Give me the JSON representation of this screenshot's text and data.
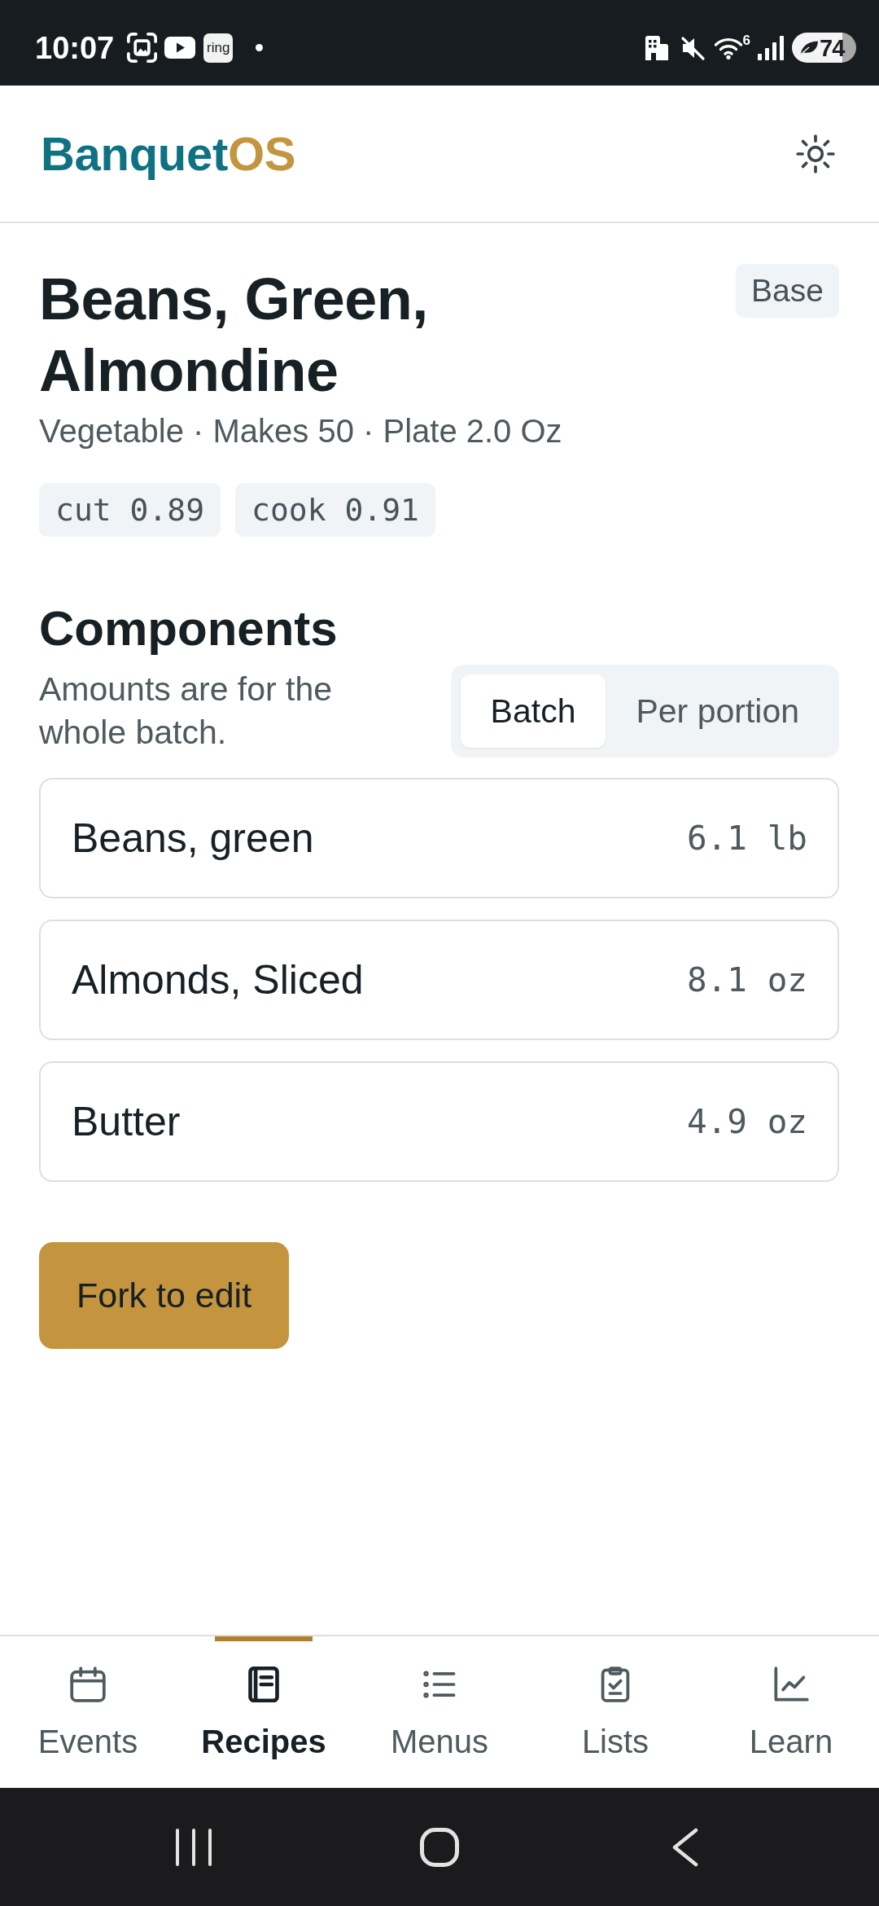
{
  "status_bar": {
    "time": "10:07",
    "app_icon_label": "ring",
    "wifi_band": "6",
    "battery": "74"
  },
  "header": {
    "logo": {
      "name": "Banquet",
      "suffix": "OS"
    }
  },
  "recipe": {
    "title": "Beans, Green, Almondine",
    "badge": "Base",
    "meta": "Vegetable · Makes 50 · Plate 2.0 Oz",
    "yields": [
      "cut 0.89",
      "cook 0.91"
    ]
  },
  "components": {
    "heading": "Components",
    "note": "Amounts are for the whole batch.",
    "modes": [
      {
        "label": "Batch",
        "selected": true
      },
      {
        "label": "Per portion",
        "selected": false
      }
    ],
    "items": [
      {
        "name": "Beans, green",
        "amount": "6.1 lb"
      },
      {
        "name": "Almonds, Sliced",
        "amount": "8.1 oz"
      },
      {
        "name": "Butter",
        "amount": "4.9 oz"
      }
    ]
  },
  "fork_button": "Fork to edit",
  "bottom_nav": [
    {
      "label": "Events",
      "selected": false
    },
    {
      "label": "Recipes",
      "selected": true
    },
    {
      "label": "Menus",
      "selected": false
    },
    {
      "label": "Lists",
      "selected": false
    },
    {
      "label": "Learn",
      "selected": false
    }
  ]
}
